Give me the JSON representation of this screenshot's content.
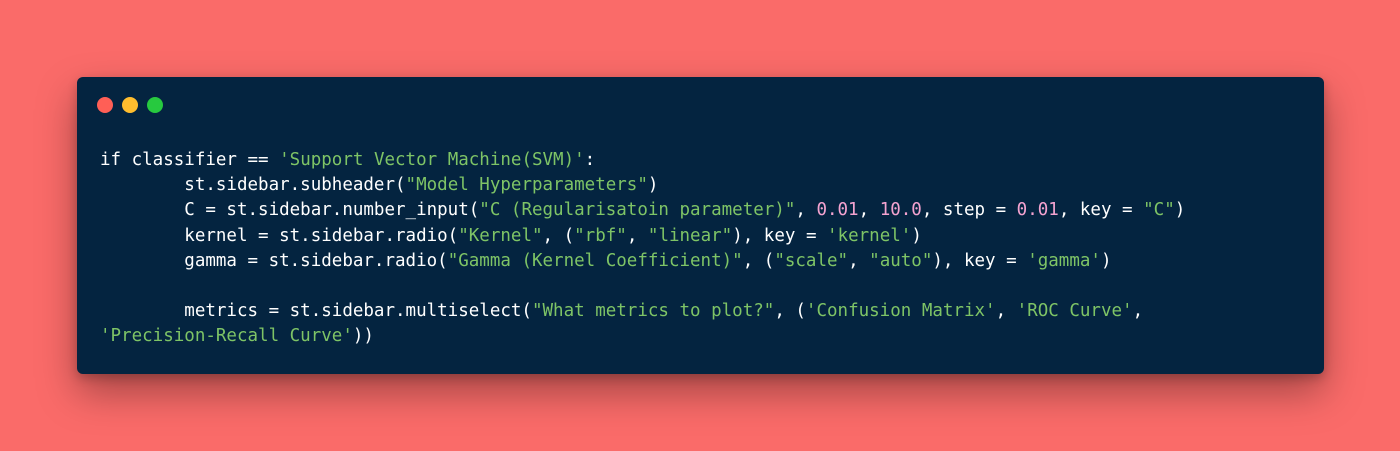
{
  "window": {
    "controls": [
      "close",
      "minimize",
      "maximize"
    ]
  },
  "colors": {
    "background": "#fa6b69",
    "window": "#042440",
    "text": "#ffffff",
    "string": "#7ec466",
    "number": "#f4a3d0"
  },
  "code": {
    "lines": [
      [
        {
          "t": "plain",
          "v": "if classifier == "
        },
        {
          "t": "str",
          "v": "'Support Vector Machine(SVM)'"
        },
        {
          "t": "plain",
          "v": ":"
        }
      ],
      [
        {
          "t": "plain",
          "v": "        st.sidebar.subheader("
        },
        {
          "t": "str",
          "v": "\"Model Hyperparameters\""
        },
        {
          "t": "plain",
          "v": ")"
        }
      ],
      [
        {
          "t": "plain",
          "v": "        C = st.sidebar.number_input("
        },
        {
          "t": "str",
          "v": "\"C (Regularisatoin parameter)\""
        },
        {
          "t": "plain",
          "v": ", "
        },
        {
          "t": "num",
          "v": "0.01"
        },
        {
          "t": "plain",
          "v": ", "
        },
        {
          "t": "num",
          "v": "10.0"
        },
        {
          "t": "plain",
          "v": ", step = "
        },
        {
          "t": "num",
          "v": "0.01"
        },
        {
          "t": "plain",
          "v": ", key = "
        },
        {
          "t": "str",
          "v": "\"C\""
        },
        {
          "t": "plain",
          "v": ")"
        }
      ],
      [
        {
          "t": "plain",
          "v": "        kernel = st.sidebar.radio("
        },
        {
          "t": "str",
          "v": "\"Kernel\""
        },
        {
          "t": "plain",
          "v": ", ("
        },
        {
          "t": "str",
          "v": "\"rbf\""
        },
        {
          "t": "plain",
          "v": ", "
        },
        {
          "t": "str",
          "v": "\"linear\""
        },
        {
          "t": "plain",
          "v": "), key = "
        },
        {
          "t": "str",
          "v": "'kernel'"
        },
        {
          "t": "plain",
          "v": ")"
        }
      ],
      [
        {
          "t": "plain",
          "v": "        gamma = st.sidebar.radio("
        },
        {
          "t": "str",
          "v": "\"Gamma (Kernel Coefficient)\""
        },
        {
          "t": "plain",
          "v": ", ("
        },
        {
          "t": "str",
          "v": "\"scale\""
        },
        {
          "t": "plain",
          "v": ", "
        },
        {
          "t": "str",
          "v": "\"auto\""
        },
        {
          "t": "plain",
          "v": "), key = "
        },
        {
          "t": "str",
          "v": "'gamma'"
        },
        {
          "t": "plain",
          "v": ")"
        }
      ],
      [],
      [
        {
          "t": "plain",
          "v": "        metrics = st.sidebar.multiselect("
        },
        {
          "t": "str",
          "v": "\"What metrics to plot?\""
        },
        {
          "t": "plain",
          "v": ", ("
        },
        {
          "t": "str",
          "v": "'Confusion Matrix'"
        },
        {
          "t": "plain",
          "v": ", "
        },
        {
          "t": "str",
          "v": "'ROC Curve'"
        },
        {
          "t": "plain",
          "v": ","
        }
      ],
      [
        {
          "t": "str",
          "v": "'Precision-Recall Curve'"
        },
        {
          "t": "plain",
          "v": "))"
        }
      ]
    ]
  }
}
